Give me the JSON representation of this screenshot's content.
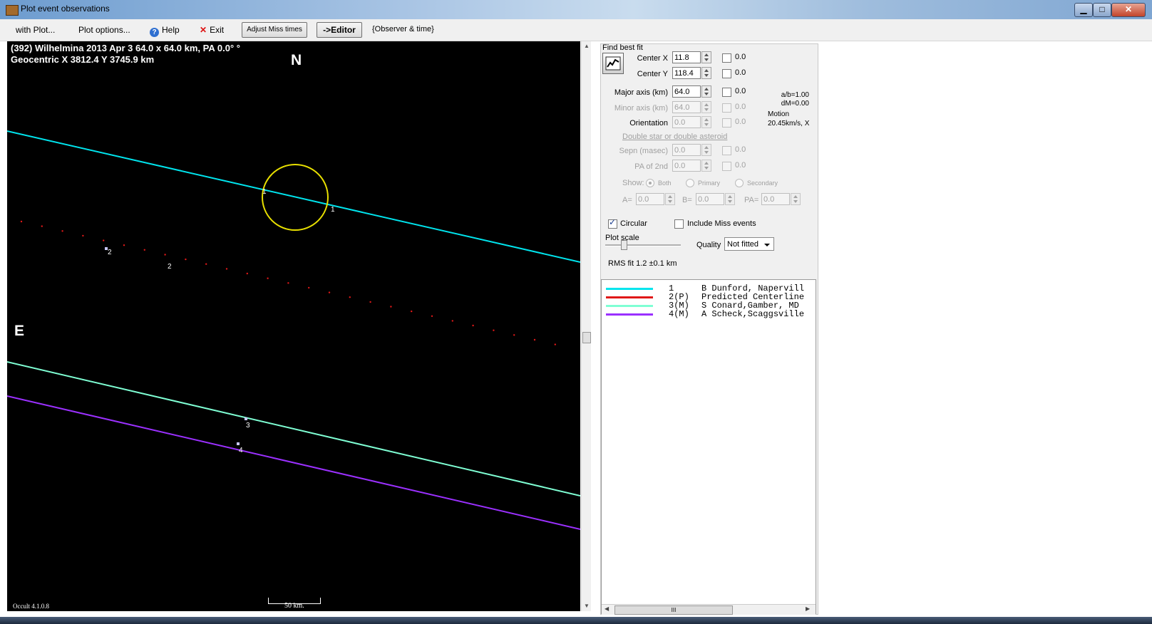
{
  "window": {
    "title": "Plot event observations",
    "minimize_glyph": "▁",
    "maximize_glyph": "□",
    "close_glyph": "✕"
  },
  "menu": {
    "with_plot": "with Plot...",
    "plot_options": "Plot options...",
    "help": "Help",
    "exit": "Exit",
    "adjust_miss": "Adjust Miss times",
    "editor": "->Editor",
    "observer_time": "{Observer & time}"
  },
  "plot": {
    "header_line1": "(392) Wilhelmina  2013 Apr 3   64.0 x 64.0 km,  PA 0.0° °",
    "header_line2": "Geocentric  X  3812.4  Y 3745.9 km",
    "north_label": "N",
    "east_label": "E",
    "scale_label": "50 km.",
    "version": "Occult 4.1.0.8",
    "chord_labels": [
      "1",
      "1",
      "2",
      "2",
      "3",
      "4"
    ]
  },
  "fit": {
    "find_best_fit": "Find best fit",
    "center_x_label": "Center X",
    "center_x": "11.8",
    "center_x_unc": "0.0",
    "center_y_label": "Center Y",
    "center_y": "118.4",
    "center_y_unc": "0.0",
    "major_label": "Major axis (km)",
    "major": "64.0",
    "major_unc": "0.0",
    "minor_label": "Minor axis (km)",
    "minor": "64.0",
    "minor_unc": "0.0",
    "orient_label": "Orientation",
    "orient": "0.0",
    "orient_unc": "0.0",
    "ab_ratio": "a/b=1.00",
    "dm": "dM=0.00",
    "motion_label": "Motion",
    "motion": "20.45km/s, X",
    "double_label": "Double star  or  double asteroid",
    "sepn_label": "Sepn (masec)",
    "sepn": "0.0",
    "sepn_unc": "0.0",
    "pa2_label": "PA of 2nd",
    "pa2": "0.0",
    "pa2_unc": "0.0",
    "show_label": "Show:",
    "show_both": "Both",
    "show_primary": "Primary",
    "show_secondary": "Secondary",
    "a_label": "A=",
    "a_val": "0.0",
    "b_label": "B=",
    "b_val": "0.0",
    "pa_label": "PA=",
    "pa_val": "0.0",
    "circular_label": "Circular",
    "include_miss_label": "Include Miss events",
    "plot_scale_label": "Plot scale",
    "quality_label": "Quality",
    "quality_value": "Not fitted",
    "rms": "RMS fit 1.2 ±0.1 km"
  },
  "legend": [
    {
      "num": "1",
      "name": "B Dunford, Napervill",
      "color": "#00e5ee"
    },
    {
      "num": "2(P)",
      "name": "Predicted Centerline",
      "color": "#e01818"
    },
    {
      "num": "3(M)",
      "name": "S Conard,Gamber, MD",
      "color": "#7fffd4"
    },
    {
      "num": "4(M)",
      "name": "A Scheck,Scaggsville",
      "color": "#9b30ff"
    }
  ],
  "legend_scroll_glyph": "III"
}
